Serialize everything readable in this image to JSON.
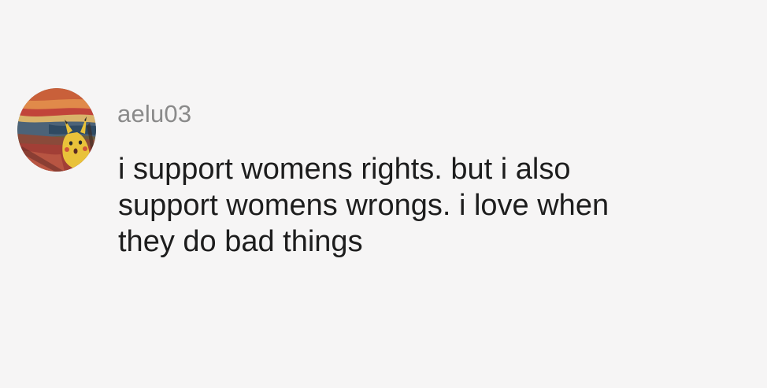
{
  "comment": {
    "avatar_icon": "scream-painting-avatar-icon",
    "username": "aelu03",
    "text_lines": [
      "i support womens rights. but i also",
      "support womens wrongs. i love when",
      "they do bad things"
    ]
  },
  "colors": {
    "background": "#f6f5f5",
    "username": "#8a8a8a",
    "text": "#1d1d1d"
  }
}
